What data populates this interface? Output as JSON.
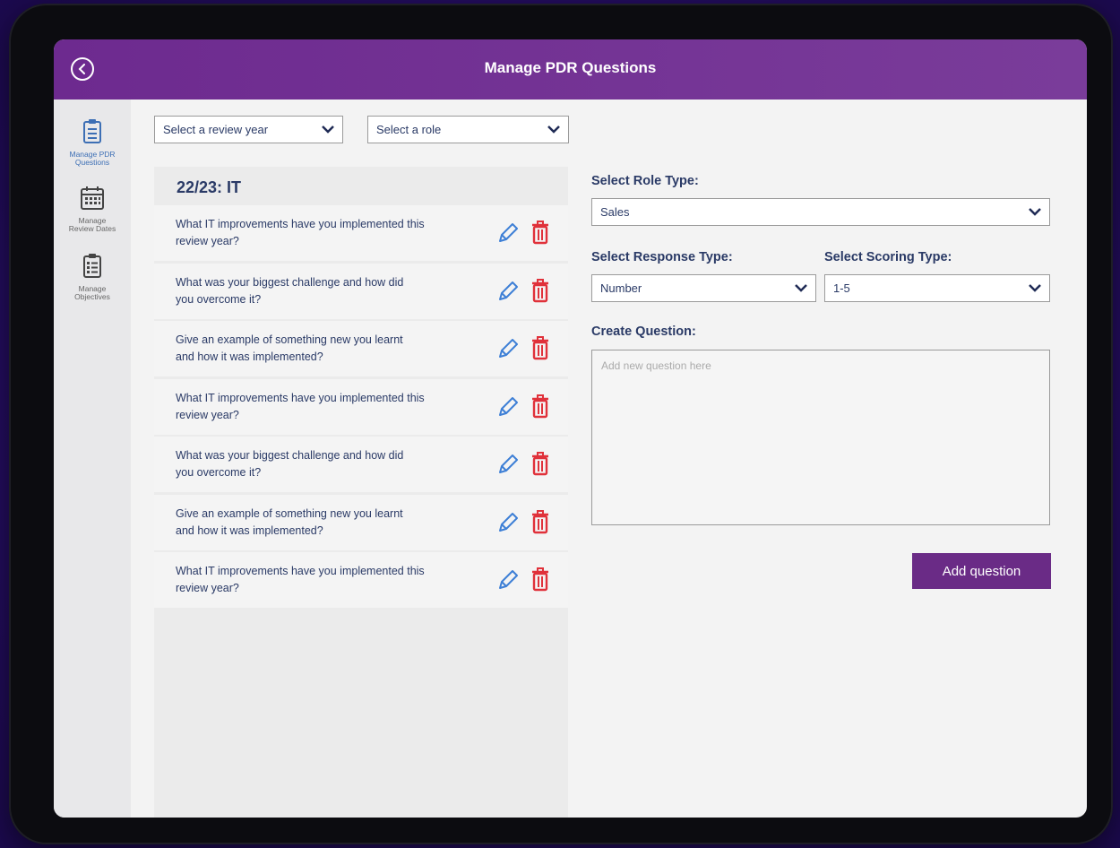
{
  "header": {
    "title": "Manage PDR Questions"
  },
  "sidebar": {
    "items": [
      {
        "label_line1": "Manage PDR",
        "label_line2": "Questions",
        "icon": "clipboard-icon",
        "active": true
      },
      {
        "label_line1": "Manage",
        "label_line2": "Review Dates",
        "icon": "calendar-icon",
        "active": false
      },
      {
        "label_line1": "Manage",
        "label_line2": "Objectives",
        "icon": "checklist-icon",
        "active": false
      }
    ]
  },
  "filters": {
    "review_year": "Select a review year",
    "role": "Select a role"
  },
  "question_list": {
    "title": "22/23: IT",
    "questions": [
      {
        "line1": "What IT improvements have you implemented this",
        "line2": "review year?"
      },
      {
        "line1": "What was your biggest challenge and how did",
        "line2": "you overcome it?"
      },
      {
        "line1": "Give an example of something new you learnt",
        "line2": "and how it was implemented?"
      },
      {
        "line1": "What IT improvements have you implemented this",
        "line2": "review year?"
      },
      {
        "line1": "What was your biggest challenge and how did",
        "line2": "you overcome it?"
      },
      {
        "line1": "Give an example of something new you learnt",
        "line2": "and how it was implemented?"
      },
      {
        "line1": "What IT improvements have you implemented this",
        "line2": "review year?"
      }
    ]
  },
  "form": {
    "role_type_label": "Select Role Type:",
    "role_type_value": "Sales",
    "response_type_label": "Select Response Type:",
    "response_type_value": "Number",
    "scoring_type_label": "Select Scoring Type:",
    "scoring_type_value": "1-5",
    "create_question_label": "Create Question:",
    "question_placeholder": "Add new question here",
    "add_button": "Add question"
  },
  "colors": {
    "header": "#6d2a8f",
    "accent_text": "#2a3a66",
    "edit_icon": "#3d7fd6",
    "delete_icon": "#e0313a",
    "button": "#6a2b86"
  }
}
